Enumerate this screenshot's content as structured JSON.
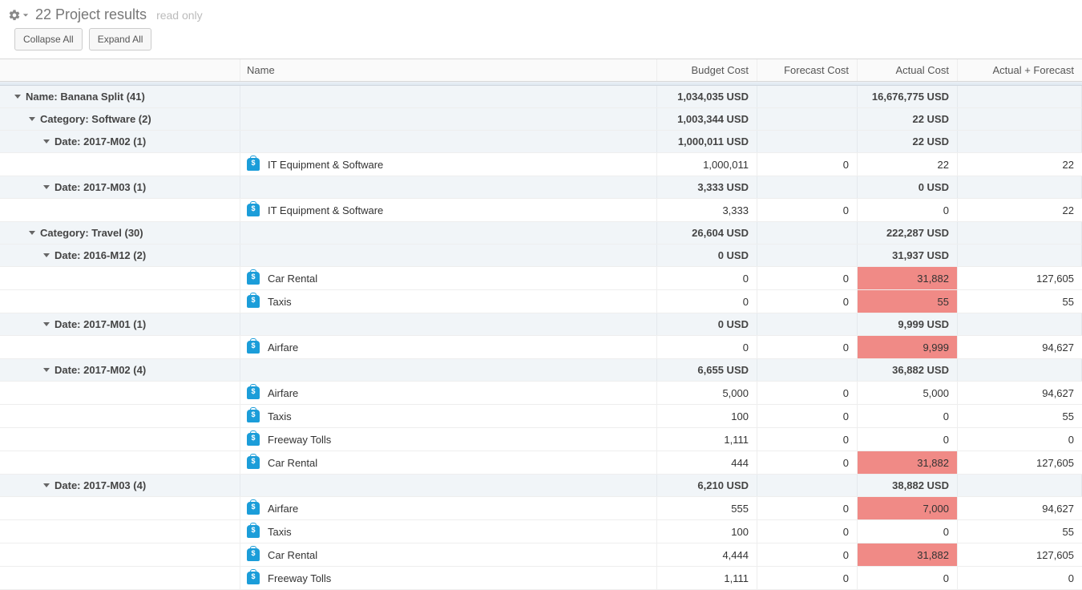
{
  "header": {
    "title": "22 Project results",
    "readonly": "read only",
    "collapse": "Collapse All",
    "expand": "Expand All"
  },
  "columns": {
    "name": "Name",
    "budget": "Budget Cost",
    "forecast": "Forecast Cost",
    "actual": "Actual Cost",
    "actfc": "Actual + Forecast"
  },
  "rows": [
    {
      "type": "group",
      "level": 1,
      "label": "Name: Banana Split (41)",
      "budget": "1,034,035 USD",
      "forecast": "",
      "actual": "16,676,775 USD",
      "actfc": ""
    },
    {
      "type": "group",
      "level": 2,
      "label": "Category: Software (2)",
      "budget": "1,003,344 USD",
      "forecast": "",
      "actual": "22 USD",
      "actfc": ""
    },
    {
      "type": "group",
      "level": 3,
      "label": "Date: 2017-M02 (1)",
      "budget": "1,000,011 USD",
      "forecast": "",
      "actual": "22 USD",
      "actfc": ""
    },
    {
      "type": "detail",
      "name": "IT Equipment & Software",
      "budget": "1,000,011",
      "forecast": "0",
      "actual": "22",
      "actfc": "22"
    },
    {
      "type": "group",
      "level": 3,
      "label": "Date: 2017-M03 (1)",
      "budget": "3,333 USD",
      "forecast": "",
      "actual": "0 USD",
      "actfc": ""
    },
    {
      "type": "detail",
      "name": "IT Equipment & Software",
      "budget": "3,333",
      "forecast": "0",
      "actual": "0",
      "actfc": "22"
    },
    {
      "type": "group",
      "level": 2,
      "label": "Category: Travel (30)",
      "budget": "26,604 USD",
      "forecast": "",
      "actual": "222,287 USD",
      "actfc": ""
    },
    {
      "type": "group",
      "level": 3,
      "label": "Date: 2016-M12 (2)",
      "budget": "0 USD",
      "forecast": "",
      "actual": "31,937 USD",
      "actfc": ""
    },
    {
      "type": "detail",
      "name": "Car Rental",
      "budget": "0",
      "forecast": "0",
      "actual": "31,882",
      "actfc": "127,605",
      "hl_actual": true
    },
    {
      "type": "detail",
      "name": "Taxis",
      "budget": "0",
      "forecast": "0",
      "actual": "55",
      "actfc": "55",
      "hl_actual": true
    },
    {
      "type": "group",
      "level": 3,
      "label": "Date: 2017-M01 (1)",
      "budget": "0 USD",
      "forecast": "",
      "actual": "9,999 USD",
      "actfc": ""
    },
    {
      "type": "detail",
      "name": "Airfare",
      "budget": "0",
      "forecast": "0",
      "actual": "9,999",
      "actfc": "94,627",
      "hl_actual": true
    },
    {
      "type": "group",
      "level": 3,
      "label": "Date: 2017-M02 (4)",
      "budget": "6,655 USD",
      "forecast": "",
      "actual": "36,882 USD",
      "actfc": ""
    },
    {
      "type": "detail",
      "name": "Airfare",
      "budget": "5,000",
      "forecast": "0",
      "actual": "5,000",
      "actfc": "94,627"
    },
    {
      "type": "detail",
      "name": "Taxis",
      "budget": "100",
      "forecast": "0",
      "actual": "0",
      "actfc": "55"
    },
    {
      "type": "detail",
      "name": "Freeway Tolls",
      "budget": "1,111",
      "forecast": "0",
      "actual": "0",
      "actfc": "0"
    },
    {
      "type": "detail",
      "name": "Car Rental",
      "budget": "444",
      "forecast": "0",
      "actual": "31,882",
      "actfc": "127,605",
      "hl_actual": true
    },
    {
      "type": "group",
      "level": 3,
      "label": "Date: 2017-M03 (4)",
      "budget": "6,210 USD",
      "forecast": "",
      "actual": "38,882 USD",
      "actfc": ""
    },
    {
      "type": "detail",
      "name": "Airfare",
      "budget": "555",
      "forecast": "0",
      "actual": "7,000",
      "actfc": "94,627",
      "hl_actual": true
    },
    {
      "type": "detail",
      "name": "Taxis",
      "budget": "100",
      "forecast": "0",
      "actual": "0",
      "actfc": "55"
    },
    {
      "type": "detail",
      "name": "Car Rental",
      "budget": "4,444",
      "forecast": "0",
      "actual": "31,882",
      "actfc": "127,605",
      "hl_actual": true
    },
    {
      "type": "detail",
      "name": "Freeway Tolls",
      "budget": "1,111",
      "forecast": "0",
      "actual": "0",
      "actfc": "0"
    }
  ]
}
